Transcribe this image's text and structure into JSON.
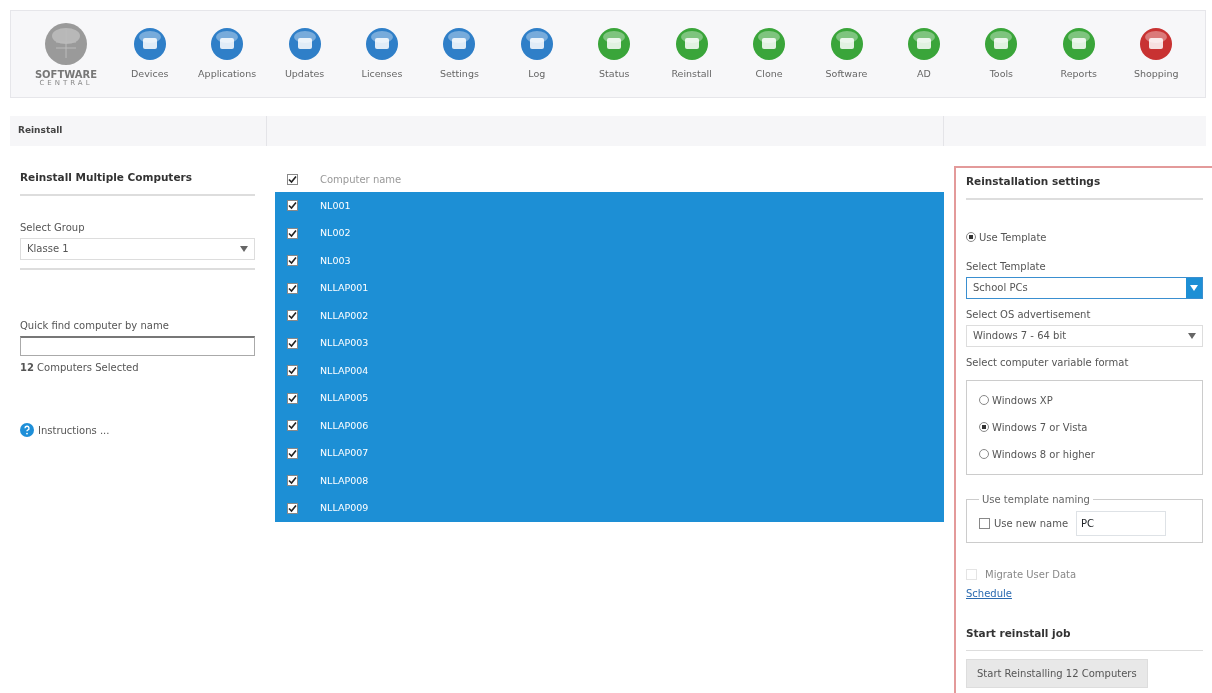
{
  "toolbar": {
    "logo": {
      "title": "SOFTWARE",
      "subtitle": "CENTRAL"
    },
    "items": [
      {
        "label": "Devices",
        "color": "#2f7fc8"
      },
      {
        "label": "Applications",
        "color": "#2f7fc8"
      },
      {
        "label": "Updates",
        "color": "#2f7fc8"
      },
      {
        "label": "Licenses",
        "color": "#2f7fc8"
      },
      {
        "label": "Settings",
        "color": "#2f7fc8"
      },
      {
        "label": "Log",
        "color": "#2f7fc8"
      },
      {
        "label": "Status",
        "color": "#3aa53a"
      },
      {
        "label": "Reinstall",
        "color": "#3aa53a"
      },
      {
        "label": "Clone",
        "color": "#3aa53a"
      },
      {
        "label": "Software",
        "color": "#3aa53a"
      },
      {
        "label": "AD",
        "color": "#3aa53a"
      },
      {
        "label": "Tools",
        "color": "#3aa53a"
      },
      {
        "label": "Reports",
        "color": "#3aa53a"
      },
      {
        "label": "Shopping",
        "color": "#c83232"
      }
    ]
  },
  "breadcrumb": "Reinstall",
  "left_panel": {
    "title": "Reinstall Multiple Computers",
    "group_label": "Select Group",
    "group_value": "Klasse 1",
    "find_label": "Quick find computer by name",
    "selected_count": "**12** Computers Selected",
    "instructions": "Instructions ..."
  },
  "table": {
    "header": {
      "label": "Computer name",
      "checked": true
    },
    "rows": [
      {
        "name": "NL001",
        "checked": true,
        "selected": true
      },
      {
        "name": "NL002",
        "checked": true,
        "selected": true
      },
      {
        "name": "NL003",
        "checked": true,
        "selected": true
      },
      {
        "name": "NLLAP001",
        "checked": true,
        "selected": true
      },
      {
        "name": "NLLAP002",
        "checked": true,
        "selected": true
      },
      {
        "name": "NLLAP003",
        "checked": true,
        "selected": true
      },
      {
        "name": "NLLAP004",
        "checked": true,
        "selected": true
      },
      {
        "name": "NLLAP005",
        "checked": true,
        "selected": true
      },
      {
        "name": "NLLAP006",
        "checked": true,
        "selected": true
      },
      {
        "name": "NLLAP007",
        "checked": true,
        "selected": true
      },
      {
        "name": "NLLAP008",
        "checked": true,
        "selected": true
      },
      {
        "name": "NLLAP009",
        "checked": true,
        "selected": true
      }
    ]
  },
  "settings": {
    "title": "Reinstallation settings",
    "use_template": {
      "label": "Use Template",
      "selected": true
    },
    "template_label": "Select Template",
    "template_value": "School PCs",
    "os_label": "Select OS advertisement",
    "os_value": "Windows 7 - 64 bit",
    "format_label": "Select computer variable format",
    "formats": [
      {
        "label": "Windows XP",
        "selected": false
      },
      {
        "label": "Windows 7 or Vista",
        "selected": true
      },
      {
        "label": "Windows 8 or higher",
        "selected": false
      }
    ],
    "naming": {
      "legend": "Use template naming",
      "checkbox_label": "Use new name",
      "checked": false,
      "value": "PC"
    },
    "migrate": {
      "label": "Migrate User Data",
      "checked": false,
      "disabled": true
    },
    "schedule": "Schedule",
    "job_title": "Start reinstall job",
    "start_button": "Start Reinstalling 12 Computers"
  }
}
